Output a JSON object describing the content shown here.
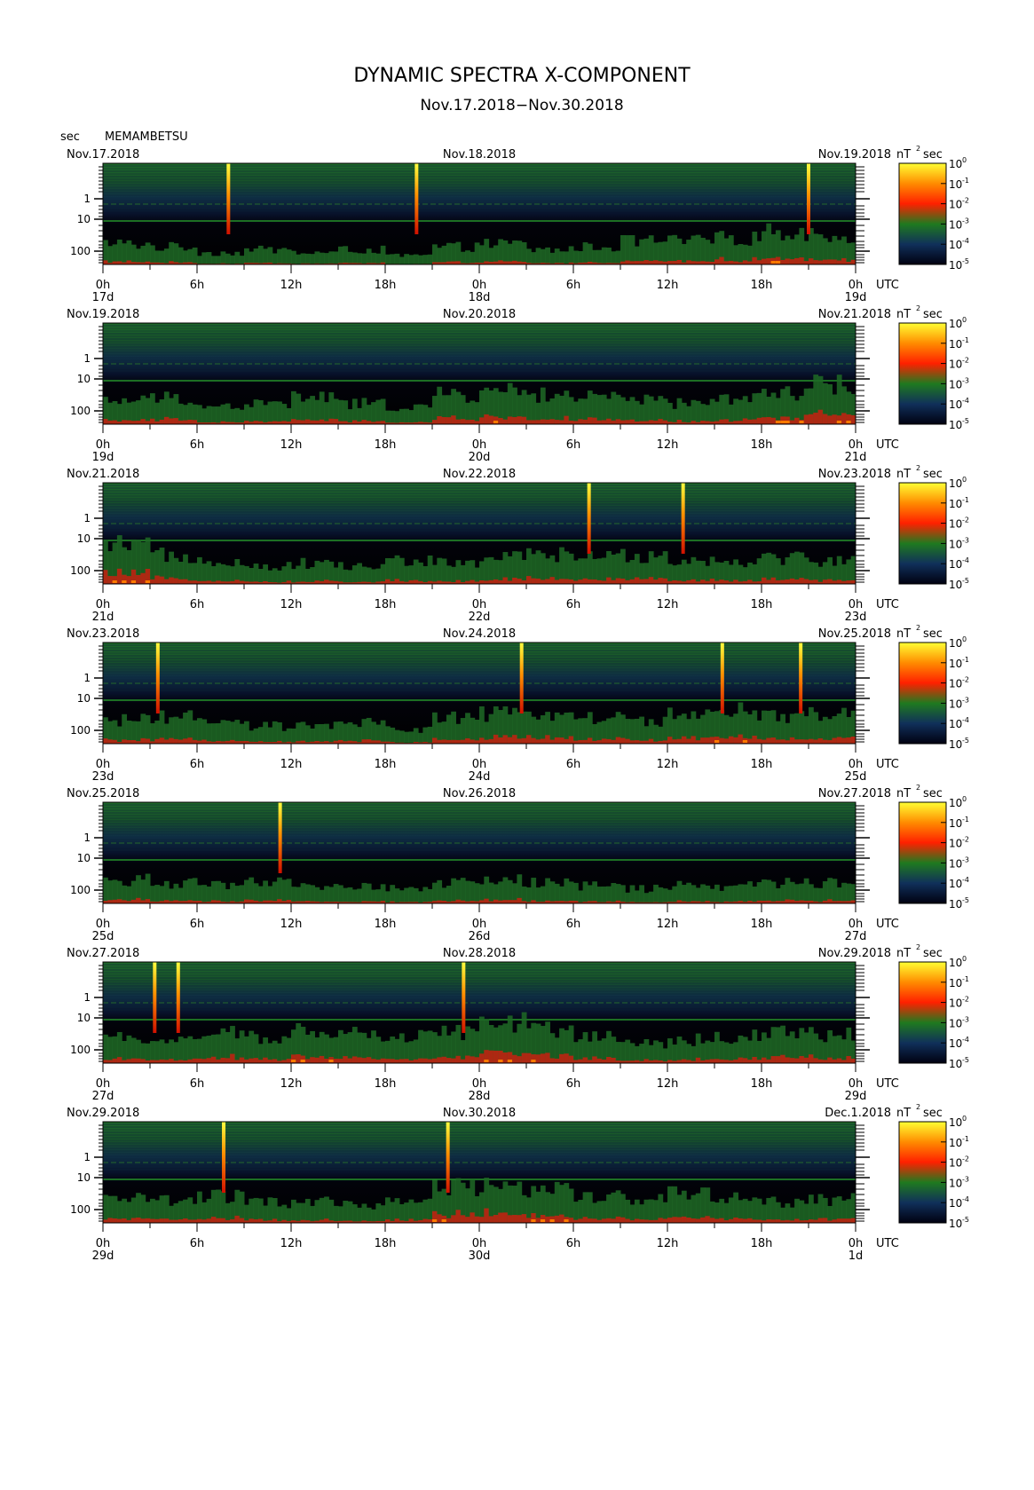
{
  "figure": {
    "title": "DYNAMIC SPECTRA X-COMPONENT",
    "subtitle": "Nov.17.2018−Nov.30.2018",
    "y_unit": "sec",
    "station": "MEMAMBETSU",
    "power_unit": "nT",
    "power_unit_exp": "2",
    "power_unit_suffix": "sec",
    "time_zone": "UTC"
  },
  "chart_data": {
    "type": "heatmap",
    "y_ticks": [
      "1",
      "10",
      "100"
    ],
    "x_ticks": [
      "0h",
      "6h",
      "12h",
      "18h",
      "0h",
      "6h",
      "12h",
      "18h",
      "0h"
    ],
    "colorbar": {
      "exponents": [
        "0",
        "-1",
        "-2",
        "-3",
        "-4",
        "-5"
      ],
      "colors": [
        "#ffff33",
        "#ff8c00",
        "#ff2000",
        "#1f7a1f",
        "#10305a",
        "#000010"
      ]
    },
    "panels": [
      {
        "left_date": "Nov.17.2018",
        "mid_date": "Nov.18.2018",
        "right_date": "Nov.19.2018",
        "day_labels": [
          "17d",
          "18d",
          "19d"
        ],
        "spikes_hours": [
          8.0,
          20.0,
          45.0
        ],
        "disturbance": [
          0.35,
          0.3,
          0.2,
          0.25,
          0.2,
          0.25,
          0.15,
          0.3,
          0.35,
          0.25,
          0.3,
          0.4,
          0.4,
          0.45,
          0.55,
          0.5
        ]
      },
      {
        "left_date": "Nov.19.2018",
        "mid_date": "Nov.20.2018",
        "right_date": "Nov.21.2018",
        "day_labels": [
          "19d",
          "20d",
          "21d"
        ],
        "spikes_hours": [],
        "disturbance": [
          0.4,
          0.45,
          0.3,
          0.35,
          0.45,
          0.35,
          0.3,
          0.5,
          0.55,
          0.5,
          0.45,
          0.4,
          0.35,
          0.45,
          0.55,
          0.7
        ]
      },
      {
        "left_date": "Nov.21.2018",
        "mid_date": "Nov.22.2018",
        "right_date": "Nov.23.2018",
        "day_labels": [
          "21d",
          "22d",
          "23d"
        ],
        "spikes_hours": [
          31.0,
          37.0
        ],
        "disturbance": [
          0.65,
          0.5,
          0.4,
          0.3,
          0.35,
          0.3,
          0.4,
          0.35,
          0.45,
          0.5,
          0.45,
          0.5,
          0.4,
          0.4,
          0.45,
          0.4
        ]
      },
      {
        "left_date": "Nov.23.2018",
        "mid_date": "Nov.24.2018",
        "right_date": "Nov.25.2018",
        "day_labels": [
          "23d",
          "24d",
          "25d"
        ],
        "spikes_hours": [
          3.5,
          26.7,
          39.5,
          44.5
        ],
        "disturbance": [
          0.4,
          0.45,
          0.35,
          0.3,
          0.3,
          0.35,
          0.25,
          0.45,
          0.5,
          0.55,
          0.45,
          0.4,
          0.5,
          0.55,
          0.45,
          0.5
        ]
      },
      {
        "left_date": "Nov.25.2018",
        "mid_date": "Nov.26.2018",
        "right_date": "Nov.27.2018",
        "day_labels": [
          "25d",
          "26d",
          "27d"
        ],
        "spikes_hours": [
          11.3
        ],
        "disturbance": [
          0.4,
          0.35,
          0.3,
          0.35,
          0.3,
          0.3,
          0.25,
          0.35,
          0.4,
          0.35,
          0.3,
          0.25,
          0.3,
          0.3,
          0.35,
          0.35
        ]
      },
      {
        "left_date": "Nov.27.2018",
        "mid_date": "Nov.28.2018",
        "right_date": "Nov.29.2018",
        "day_labels": [
          "27d",
          "28d",
          "29d"
        ],
        "spikes_hours": [
          3.3,
          4.8,
          23.0
        ],
        "disturbance": [
          0.45,
          0.4,
          0.5,
          0.45,
          0.55,
          0.5,
          0.45,
          0.55,
          0.7,
          0.6,
          0.45,
          0.35,
          0.4,
          0.45,
          0.5,
          0.5
        ]
      },
      {
        "left_date": "Nov.29.2018",
        "mid_date": "Nov.30.2018",
        "right_date": "Dec.1.2018",
        "day_labels": [
          "29d",
          "30d",
          "1d"
        ],
        "spikes_hours": [
          7.7,
          22.0
        ],
        "disturbance": [
          0.45,
          0.4,
          0.45,
          0.35,
          0.35,
          0.3,
          0.35,
          0.6,
          0.65,
          0.55,
          0.45,
          0.4,
          0.5,
          0.45,
          0.35,
          0.4
        ]
      }
    ]
  }
}
